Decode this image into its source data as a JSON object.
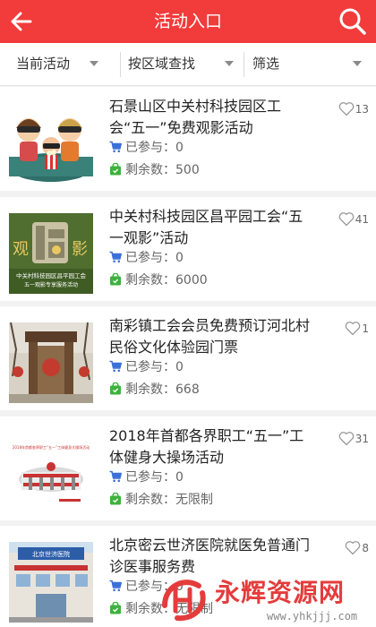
{
  "header": {
    "title": "活动入口",
    "back_icon": "back-arrow-icon",
    "search_icon": "search-icon",
    "bg_color": "#f23b3b"
  },
  "filters": [
    {
      "label": "当前活动"
    },
    {
      "label": "按区域查找"
    },
    {
      "label": "筛选"
    }
  ],
  "activities": [
    {
      "title": "石景山区中关村科技园区工会“五一”免费观影活动",
      "likes": "13",
      "joined_label": "已参与：0",
      "remaining_label": "剩余数：500"
    },
    {
      "title": "中关村科技园区昌平园工会“五一观影”活动",
      "likes": "41",
      "joined_label": "已参与：0",
      "remaining_label": "剩余数：6000"
    },
    {
      "title": "南彩镇工会会员免费预订河北村民俗文化体验园门票",
      "likes": "1",
      "joined_label": "已参与：0",
      "remaining_label": "剩余数：668"
    },
    {
      "title": "2018年首都各界职工“五一”工体健身大操场活动",
      "likes": "31",
      "joined_label": "已参与：0",
      "remaining_label": "剩余数：无限制"
    },
    {
      "title": "北京密云世济医院就医免普通门诊医事服务费",
      "likes": "8",
      "joined_label": "已参与：0",
      "remaining_label": "剩余数：无限制"
    }
  ],
  "thumb2": {
    "left_text": "观",
    "right_text": "影",
    "caption1": "中关村科技园区昌平园工会",
    "caption2": "五一观影专享服务活动"
  },
  "thumb4": {
    "banner_text": "2018年首都各界职工“五一”工体健身大操场活动"
  },
  "thumb5": {
    "sign_text": "北京世济医院"
  },
  "watermark": {
    "text": "永辉资源网",
    "url": "www.yhkjjj.com"
  },
  "colors": {
    "accent": "#f23b3b",
    "cart_icon": "#3b6fd9",
    "bag_icon": "#3db23d"
  }
}
